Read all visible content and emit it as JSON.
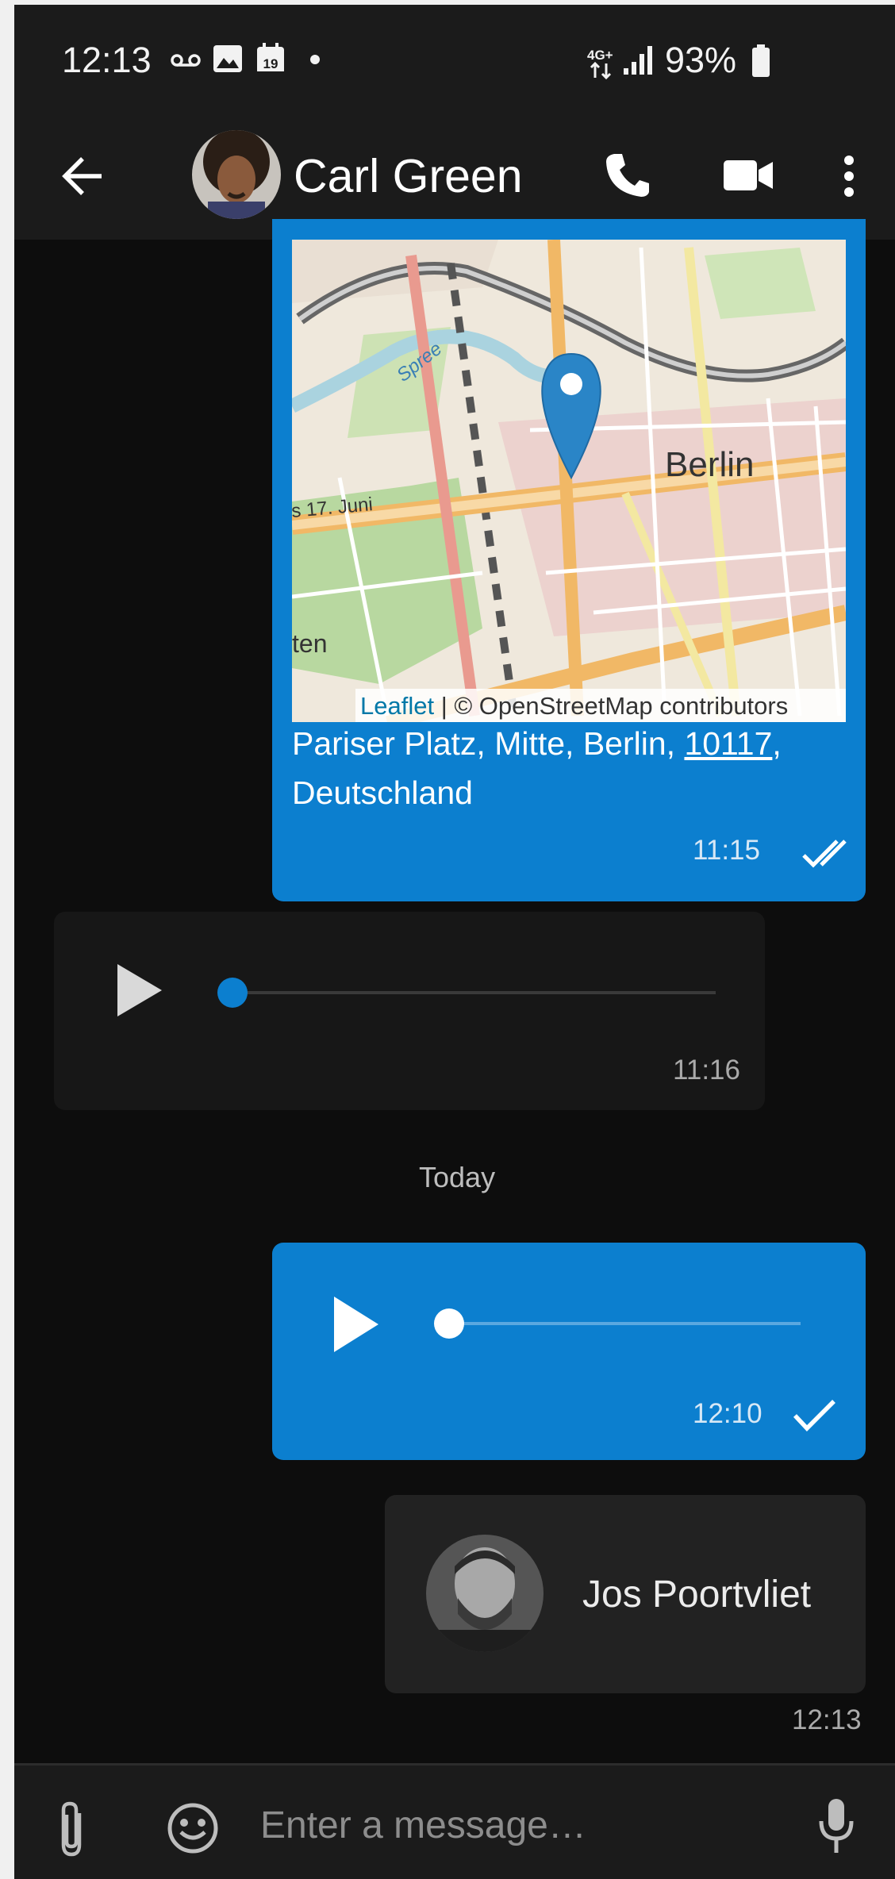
{
  "status_bar": {
    "time": "12:13",
    "network": "4G+",
    "battery": "93%"
  },
  "toolbar": {
    "contact_name": "Carl Green"
  },
  "messages": {
    "location": {
      "map_attribution_link": "Leaflet",
      "map_attribution_rest": " | © OpenStreetMap contributors",
      "map_label_city": "Berlin",
      "map_label_street": "s 17. Juni",
      "map_label_river": "Spree",
      "map_label_left": "ten",
      "address_part1": "Pariser Platz, Mitte, Berlin, ",
      "address_zip": "10117",
      "address_part2": ",",
      "address_line2": "Deutschland",
      "time": "11:15"
    },
    "audio_in": {
      "time": "11:16",
      "progress": 0.0
    },
    "date_divider": "Today",
    "audio_out": {
      "time": "12:10",
      "progress": 0.0
    },
    "contact_card": {
      "name": "Jos Poortvliet",
      "time": "12:13"
    }
  },
  "compose": {
    "placeholder": "Enter a message…"
  },
  "colors": {
    "accent": "#0c7fcf",
    "background": "#0d0d0d",
    "bar": "#1b1b1b"
  }
}
